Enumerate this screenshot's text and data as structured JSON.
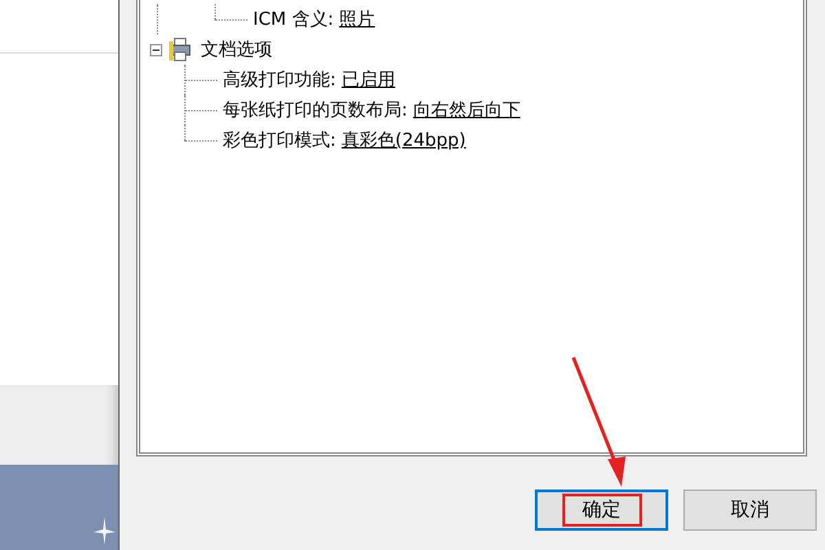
{
  "tree": {
    "items": [
      {
        "kind": "orphan",
        "label": "ICM 含义:",
        "value": "照片"
      },
      {
        "kind": "group",
        "label": "文档选项",
        "expanded": true,
        "children": [
          {
            "label": "高级打印功能:",
            "value": "已启用"
          },
          {
            "label": "每张纸打印的页数布局:",
            "value": "向右然后向下"
          },
          {
            "label": "彩色打印模式:",
            "value": "真彩色(24bpp)"
          }
        ]
      }
    ]
  },
  "buttons": [
    {
      "label": "确定",
      "focused": true,
      "annotated": true
    },
    {
      "label": "取消",
      "focused": false,
      "annotated": false
    }
  ]
}
